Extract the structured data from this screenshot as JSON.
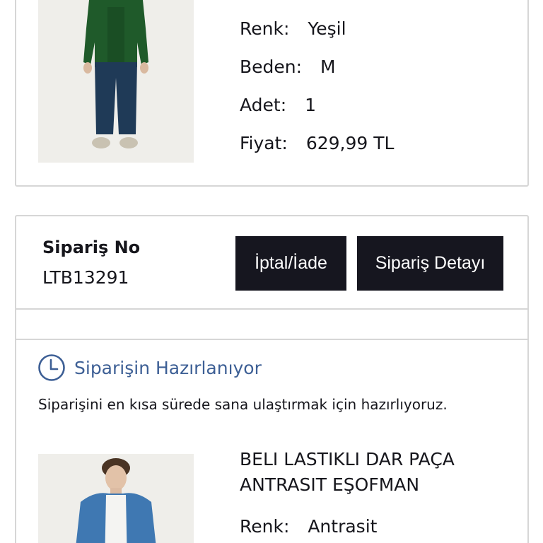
{
  "order_item_1": {
    "color_label": "Renk:",
    "color_value": "Yeşil",
    "size_label": "Beden:",
    "size_value": "M",
    "qty_label": "Adet:",
    "qty_value": "1",
    "price_label": "Fiyat:",
    "price_value": "629,99 TL"
  },
  "order_2": {
    "order_no_label": "Sipariş No",
    "order_no_value": "LTB13291",
    "cancel_button": "İptal/İade",
    "detail_button": "Sipariş Detayı",
    "status_icon": "clock-icon",
    "status_text": "Siparişin Hazırlanıyor",
    "status_description": "Siparişini en kısa sürede sana ulaştırmak için hazırlıyoruz.",
    "product_name": "BELI LASTIKLI DAR PAÇA ANTRASIT EŞOFMAN",
    "color_label": "Renk:",
    "color_value": "Antrasit"
  },
  "colors": {
    "button_bg": "#16161f",
    "status_blue": "#3d5f95",
    "border": "#d6d6d6"
  }
}
